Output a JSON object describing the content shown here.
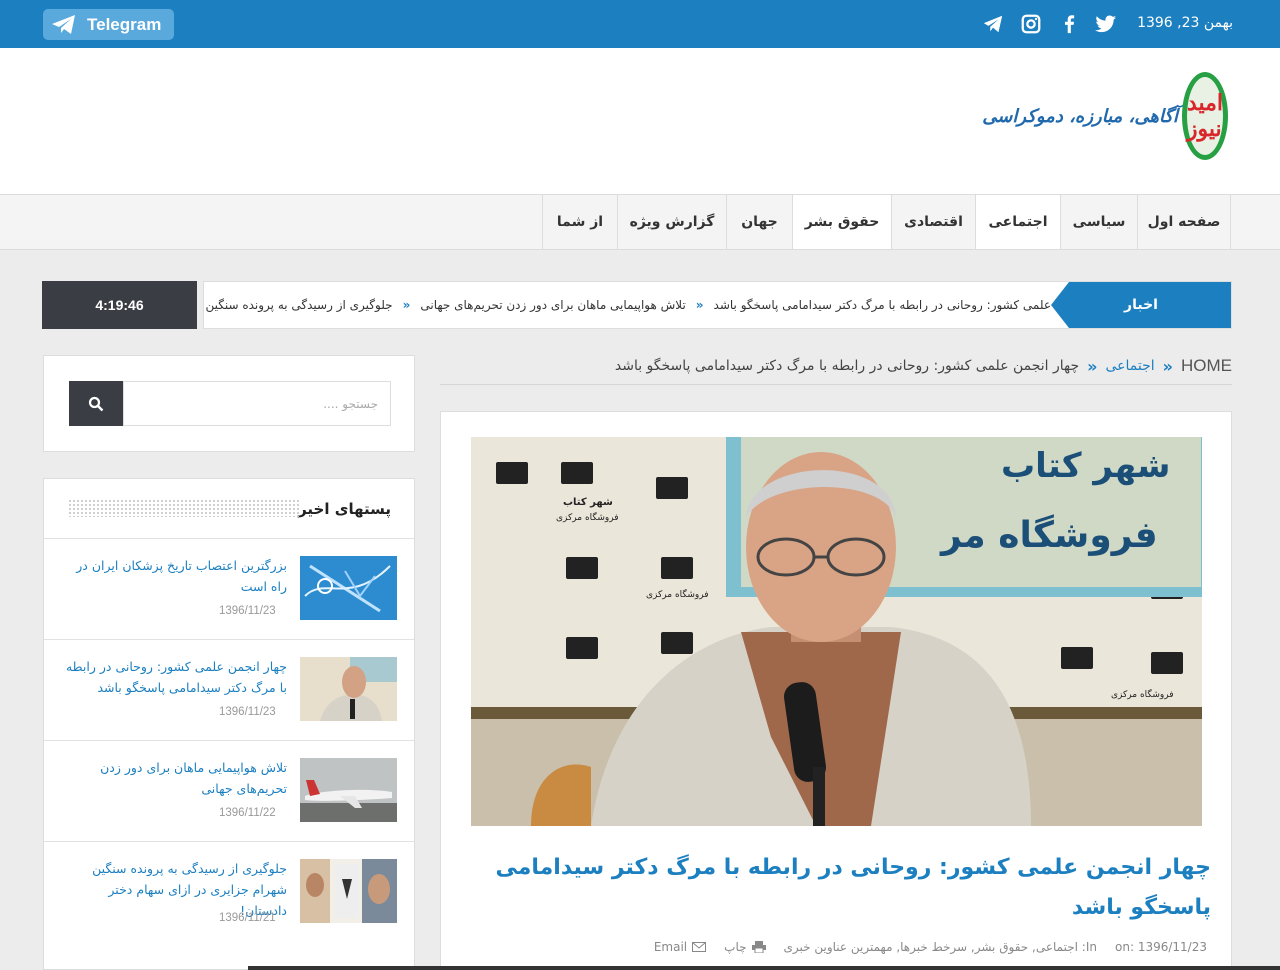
{
  "colors": {
    "primary": "#1b7fc0",
    "dark": "#3a3d44",
    "logo_green": "#27a044",
    "logo_red": "#d9262b"
  },
  "topbar": {
    "telegram_label": "Telegram",
    "date": "بهمن 23, 1396",
    "social_icons": [
      "telegram-icon",
      "instagram-icon",
      "facebook-icon",
      "twitter-icon"
    ]
  },
  "logo": {
    "name": "امید نیوز",
    "tagline": "آگاهی، مبارزه، دموکراسی"
  },
  "nav": {
    "items": [
      {
        "label": "صفحه اول"
      },
      {
        "label": "سیاسی"
      },
      {
        "label": "اجتماعی"
      },
      {
        "label": "اقتصادی"
      },
      {
        "label": "حقوق بشر"
      },
      {
        "label": "جهان"
      },
      {
        "label": "گزارش ویژه"
      },
      {
        "label": "از شما"
      }
    ]
  },
  "ticker": {
    "label": "اخبار",
    "time": "4:19:46",
    "items": [
      "علمی کشور: روحانی در رابطه با مرگ دکتر سیدامامی پاسخگو باشد",
      "تلاش هواپیمایی ماهان برای دور زدن تحریم‌های جهانی",
      "جلوگیری از رسیدگی به پرونده سنگین"
    ],
    "separator": "«"
  },
  "breadcrumb": {
    "home": "HOME",
    "separator": "«",
    "category": "اجتماعی",
    "current": "چهار انجمن علمی کشور: روحانی در رابطه با مرگ دکتر سیدامامی پاسخگو باشد"
  },
  "article": {
    "title": "چهار انجمن علمی کشور: روحانی در رابطه با مرگ دکتر سیدامامی پاسخگو باشد",
    "photo_signs": {
      "big": "شهر کتاب",
      "big2": "فروشگاه مر",
      "small1": "شهر کتاب",
      "small2": "فروشگاه مرکزی"
    },
    "meta": {
      "on_label": "on:",
      "date": "1396/11/23",
      "in_label": "In:",
      "categories": "اجتماعی, حقوق بشر, سرخط خبرها, مهمترین عناوین خبری",
      "print_label": "چاپ",
      "email_label": "Email"
    }
  },
  "search": {
    "placeholder": "جستجو ...."
  },
  "recent": {
    "heading": "پستهای اخیر",
    "posts": [
      {
        "title": "بزرگترین اعتصاب تاریخ پزشکان ایران در راه است",
        "date": "1396/11/23"
      },
      {
        "title": "چهار انجمن علمی کشور: روحانی در رابطه با مرگ دکتر سیدامامی پاسخگو باشد",
        "date": "1396/11/23"
      },
      {
        "title": "تلاش هواپیمایی ماهان برای دور زدن تحریم‌های جهانی",
        "date": "1396/11/22"
      },
      {
        "title": "جلوگیری از رسیدگی به پرونده سنگین شهرام جزایری در ازای سهام دختر دادستان!",
        "date": "1396/11/21"
      }
    ]
  }
}
